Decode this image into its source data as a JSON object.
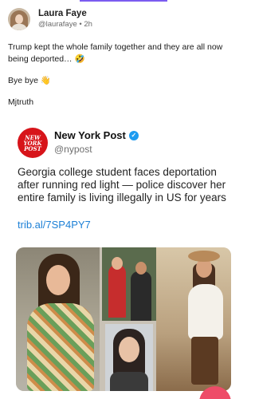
{
  "post": {
    "author": {
      "display_name": "Laura Faye",
      "handle": "@laurafaye",
      "separator": "•",
      "time": "2h",
      "avatar_icon": "user-avatar"
    },
    "options_icon": "more-options-icon",
    "paragraphs": [
      "Trump kept the whole family together and they are all now being deported… 🤣",
      "Bye bye 👋",
      "Mjtruth"
    ]
  },
  "embed": {
    "logo_lines": [
      "NEW",
      "YORK",
      "POST"
    ],
    "name": "New York Post",
    "verified_icon": "verified-badge-icon",
    "verified_glyph": "✓",
    "handle": "@nypost",
    "headline": "Georgia college student faces deportation after running red light — police discover her entire family is living illegally in US for years",
    "link": "trib.al/7SP4PY7",
    "photo_collage": "photo-collage"
  },
  "colors": {
    "accent": "#7b5cf0",
    "nypost_red": "#d7141a",
    "verified_blue": "#1d9bf0",
    "link_blue": "#1d80d6",
    "fab_pink": "#ee4c68"
  }
}
